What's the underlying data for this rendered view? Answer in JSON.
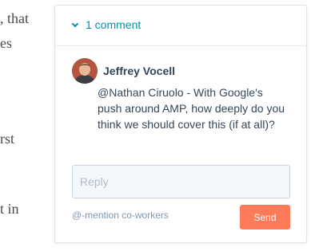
{
  "document": {
    "fragments": [
      ", that",
      "es",
      "rst",
      "t in"
    ]
  },
  "comments_panel": {
    "toggle_label": "1 comment",
    "comment": {
      "author": "Jeffrey Vocell",
      "mention": "@Nathan Ciruolo",
      "text": " - With Google's push around AMP, how deeply do you think we should cover this (if at all)?"
    },
    "reply": {
      "placeholder": "Reply",
      "value": ""
    },
    "mention_hint": "@-mention co-workers",
    "send_label": "Send"
  },
  "colors": {
    "accent": "#0091ae",
    "send_button": "#ff7a59",
    "text": "#33475b",
    "muted": "#7c98b6"
  }
}
